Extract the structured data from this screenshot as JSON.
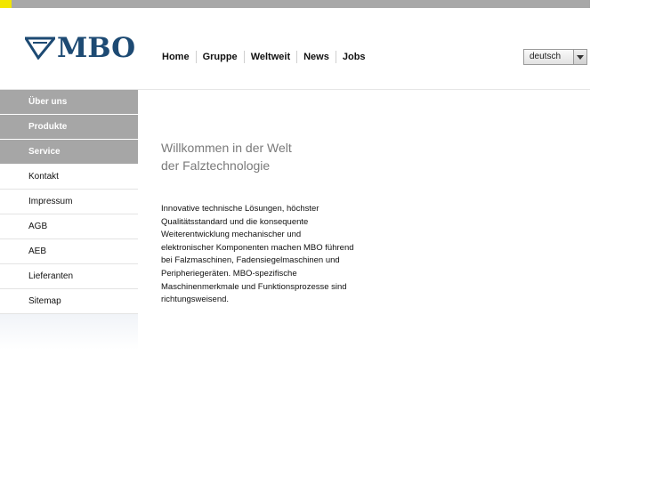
{
  "brand": {
    "logo_text": "MBO",
    "color": "#1d4a73",
    "accent": "#f2e600"
  },
  "nav": [
    {
      "label": "Home"
    },
    {
      "label": "Gruppe"
    },
    {
      "label": "Weltweit"
    },
    {
      "label": "News"
    },
    {
      "label": "Jobs"
    }
  ],
  "language": {
    "selected": "deutsch"
  },
  "sidebar": {
    "items": [
      {
        "label": "Über uns",
        "style": "dark"
      },
      {
        "label": "Produkte",
        "style": "dark"
      },
      {
        "label": "Service",
        "style": "dark"
      },
      {
        "label": "Kontakt",
        "style": "light"
      },
      {
        "label": "Impressum",
        "style": "light"
      },
      {
        "label": "AGB",
        "style": "light"
      },
      {
        "label": "AEB",
        "style": "light"
      },
      {
        "label": "Lieferanten",
        "style": "light"
      },
      {
        "label": "Sitemap",
        "style": "light"
      }
    ]
  },
  "main": {
    "title_line1": "Willkommen in der Welt",
    "title_line2": "der Falztechnologie",
    "body_lines": [
      "Innovative technische Lösungen, höchster",
      "Qualitätsstandard und die konsequente",
      "Weiterentwicklung mechanischer und",
      "elektronischer Komponenten machen MBO führend",
      "bei Falzmaschinen, Fadensiegelmaschinen und",
      "Peripheriegeräten. MBO-spezifische",
      "Maschinenmerkmale und Funktionsprozesse sind",
      "richtungsweisend."
    ]
  }
}
